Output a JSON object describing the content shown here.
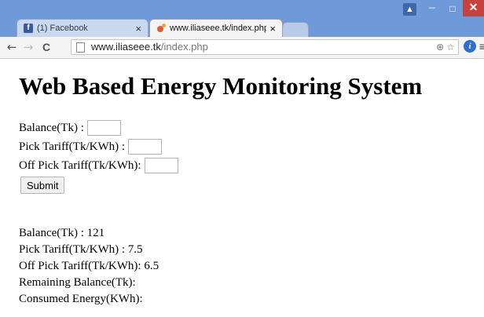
{
  "browser": {
    "tabs": [
      {
        "label": "(1) Facebook",
        "close": "×"
      },
      {
        "label": "www.iliaseee.tk/index.php",
        "close": "×"
      }
    ],
    "url_host": "www.iliaseee.tk",
    "url_path": "/index.php",
    "buttons": {
      "back": "←",
      "forward": "→",
      "reload": "C",
      "user": "▲",
      "minimize": "–",
      "maximize": "□",
      "close": "✕",
      "menu": "≡",
      "zoom": "⊕",
      "star": "☆",
      "extension": "i"
    }
  },
  "page": {
    "title": "Web Based Energy Monitoring System",
    "form": {
      "balance_label": "Balance(Tk) :",
      "pick_label": "Pick Tariff(Tk/KWh) :",
      "offpick_label": "Off Pick Tariff(Tk/KWh):",
      "balance_value": "",
      "pick_value": "",
      "offpick_value": "",
      "submit_label": "Submit"
    },
    "results": [
      "Balance(Tk) : 121",
      "Pick Tariff(Tk/KWh) : 7.5",
      "Off Pick Tariff(Tk/KWh): 6.5",
      "Remaining Balance(Tk):",
      "Consumed Energy(KWh):"
    ]
  },
  "colors": {
    "titlebar": "#6f9ad9",
    "close_button": "#c7423c"
  }
}
